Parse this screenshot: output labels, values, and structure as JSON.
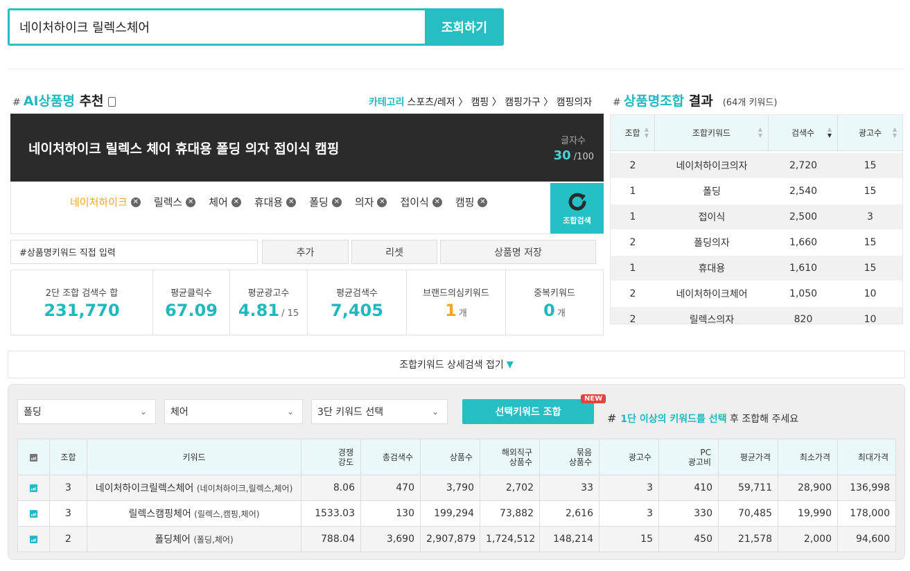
{
  "search": {
    "value": "네이처하이크 릴렉스체어",
    "button": "조회하기"
  },
  "ai": {
    "hash": "#",
    "title_highlight": "AI상품명",
    "title_rest": "추천",
    "category_label": "카테고리",
    "category_path": "스포츠/레저 〉 캠핑 〉 캠핑가구 〉 캠핑의자",
    "product_name": "네이처하이크 릴렉스 체어 휴대용 폴딩 의자 접이식 캠핑",
    "char_count_label": "글자수",
    "char_count": "30",
    "char_max": "/100",
    "chips": [
      "네이처하이크",
      "릴렉스",
      "체어",
      "휴대용",
      "폴딩",
      "의자",
      "접이식",
      "캠핑"
    ],
    "combine_search": "조합검색",
    "direct_input_placeholder": "#상품명키워드 직접 입력",
    "add": "추가",
    "reset": "리셋",
    "save": "상품명 저장"
  },
  "stats": [
    {
      "label": "2단 조합 검색수 합",
      "value": "231,770",
      "sub": ""
    },
    {
      "label": "평균클릭수",
      "value": "67.09",
      "sub": ""
    },
    {
      "label": "평균광고수",
      "value": "4.81",
      "sub": "/ 15"
    },
    {
      "label": "평균검색수",
      "value": "7,405",
      "sub": ""
    },
    {
      "label": "브랜드의심키워드",
      "value": "1",
      "sub": "개"
    },
    {
      "label": "중복키워드",
      "value": "0",
      "sub": "개"
    }
  ],
  "combo": {
    "hash": "#",
    "title_highlight": "상품명조합",
    "title_rest": "결과",
    "count": "(64개 키워드)",
    "headers": [
      "조합",
      "조합키워드",
      "검색수",
      "광고수"
    ],
    "rows": [
      [
        "2",
        "네이처하이크의자",
        "2,720",
        "15"
      ],
      [
        "1",
        "폴딩",
        "2,540",
        "15"
      ],
      [
        "1",
        "접이식",
        "2,500",
        "3"
      ],
      [
        "2",
        "폴딩의자",
        "1,660",
        "15"
      ],
      [
        "1",
        "휴대용",
        "1,610",
        "15"
      ],
      [
        "2",
        "네이처하이크체어",
        "1,050",
        "10"
      ],
      [
        "2",
        "릴렉스의자",
        "820",
        "10"
      ]
    ]
  },
  "detail": {
    "toggle": "조합키워드 상세검색 접기",
    "select1": "폴딩",
    "select2": "체어",
    "select3": "3단 키워드 선택",
    "combine_button": "선택키워드 조합",
    "new_badge": "NEW",
    "hint_hash": "#",
    "hint_highlight": "1단 이상의 키워드를 선택",
    "hint_rest": " 후 조합해 주세요",
    "headers": [
      "조합",
      "키워드",
      "경쟁\n강도",
      "총검색수",
      "상품수",
      "해외직구\n상품수",
      "묶음\n상품수",
      "광고수",
      "PC\n광고비",
      "평균가격",
      "최소가격",
      "최대가격"
    ],
    "rows": [
      {
        "combo": "3",
        "keyword": "네이처하이크릴렉스체어",
        "parts": "(네이처하이크,릴렉스,체어)",
        "competition": "8.06",
        "total_search": "470",
        "products": "3,790",
        "overseas": "2,702",
        "bundle": "33",
        "ads": "3",
        "pc_ad": "410",
        "avg": "59,711",
        "min": "28,900",
        "max": "136,998"
      },
      {
        "combo": "3",
        "keyword": "릴렉스캠핑체어",
        "parts": "(릴렉스,캠핑,체어)",
        "competition": "1533.03",
        "total_search": "130",
        "products": "199,294",
        "overseas": "73,882",
        "bundle": "2,616",
        "ads": "3",
        "pc_ad": "330",
        "avg": "70,485",
        "min": "19,990",
        "max": "178,000"
      },
      {
        "combo": "2",
        "keyword": "폴딩체어",
        "parts": "(폴딩,체어)",
        "competition": "788.04",
        "total_search": "3,690",
        "products": "2,907,879",
        "overseas": "1,724,512",
        "bundle": "148,214",
        "ads": "15",
        "pc_ad": "450",
        "avg": "21,578",
        "min": "2,000",
        "max": "94,600"
      }
    ]
  }
}
